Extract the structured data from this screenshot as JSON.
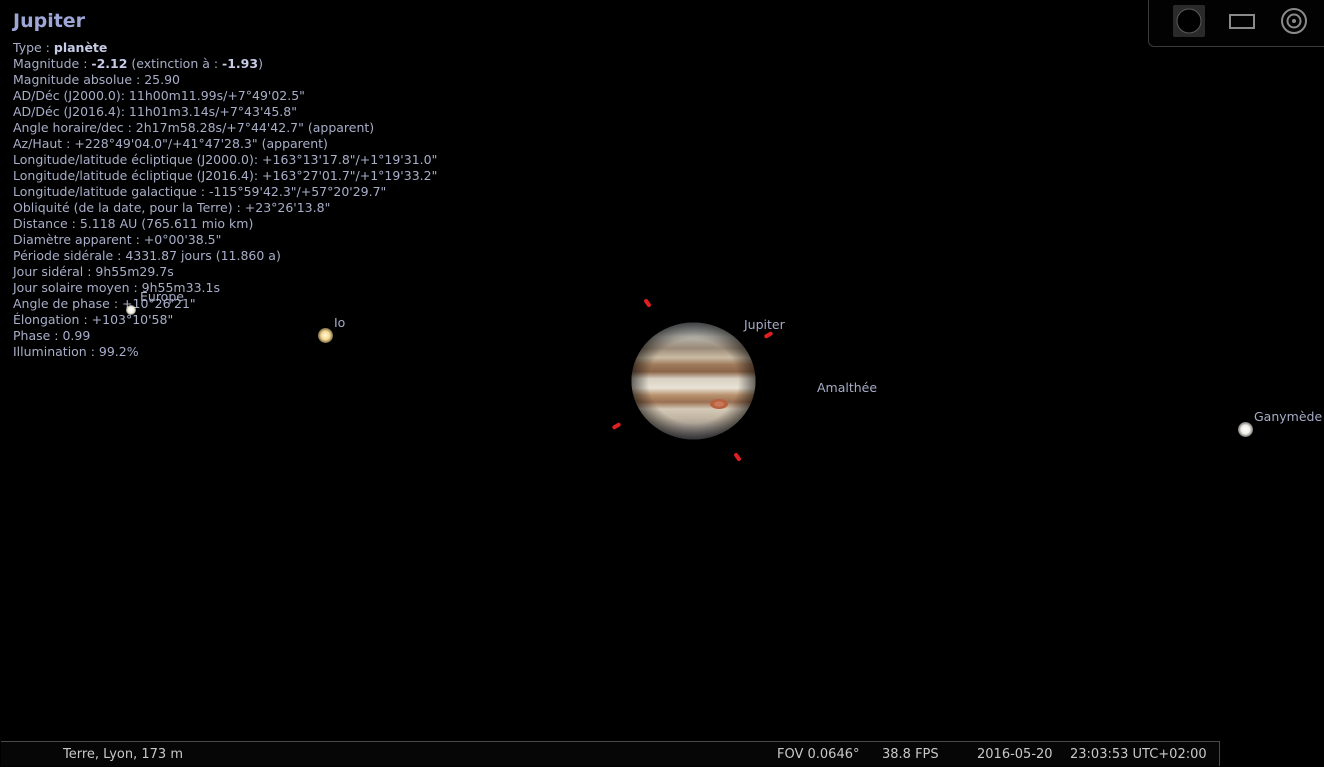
{
  "object": {
    "name": "Jupiter",
    "type_label": "Type : ",
    "type_value": "planète",
    "magnitude_label": "Magnitude : ",
    "magnitude_value": "-2.12",
    "magnitude_ext_label": " (extinction à : ",
    "magnitude_ext_value": "-1.93",
    "magnitude_ext_close": ")",
    "lines": [
      "Magnitude absolue : 25.90",
      "AD/Déc (J2000.0): 11h00m11.99s/+7°49'02.5\"",
      "AD/Déc (J2016.4): 11h01m3.14s/+7°43'45.8\"",
      "Angle horaire/dec : 2h17m58.28s/+7°44'42.7\" (apparent)",
      "Az/Haut : +228°49'04.0\"/+41°47'28.3\" (apparent)",
      "Longitude/latitude écliptique (J2000.0): +163°13'17.8\"/+1°19'31.0\"",
      "Longitude/latitude écliptique (J2016.4): +163°27'01.7\"/+1°19'33.2\"",
      "Longitude/latitude galactique : -115°59'42.3\"/+57°20'29.7\"",
      "Obliquité (de la date, pour la Terre) : +23°26'13.8\"",
      "Distance : 5.118 AU (765.611 mio km)",
      "Diamètre apparent : +0°00'38.5\"",
      "Période sidérale : 4331.87 jours (11.860 a)",
      "Jour sidéral : 9h55m29.7s",
      "Jour solaire moyen : 9h55m33.1s",
      "Angle de phase : +10°26'21\"",
      "Élongation : +103°10'58\"",
      "Phase : 0.99",
      "Illumination : 99.2%"
    ]
  },
  "sky_labels": {
    "europe": "Europe",
    "io": "Io",
    "jupiter": "Jupiter",
    "amalthee": "Amalthée",
    "ganymede": "Ganymède"
  },
  "toolbar": {
    "icons": [
      "planet-disk-icon",
      "ocular-frame-icon",
      "target-circle-icon"
    ]
  },
  "statusbar": {
    "location": "Terre, Lyon, 173 m",
    "fov": "FOV 0.0646°",
    "fps": "38.8 FPS",
    "date": "2016-05-20",
    "time": "23:03:53 UTC+02:00"
  },
  "colors": {
    "info_text": "#a8aec8",
    "marker": "#e02020",
    "background": "#000000"
  }
}
